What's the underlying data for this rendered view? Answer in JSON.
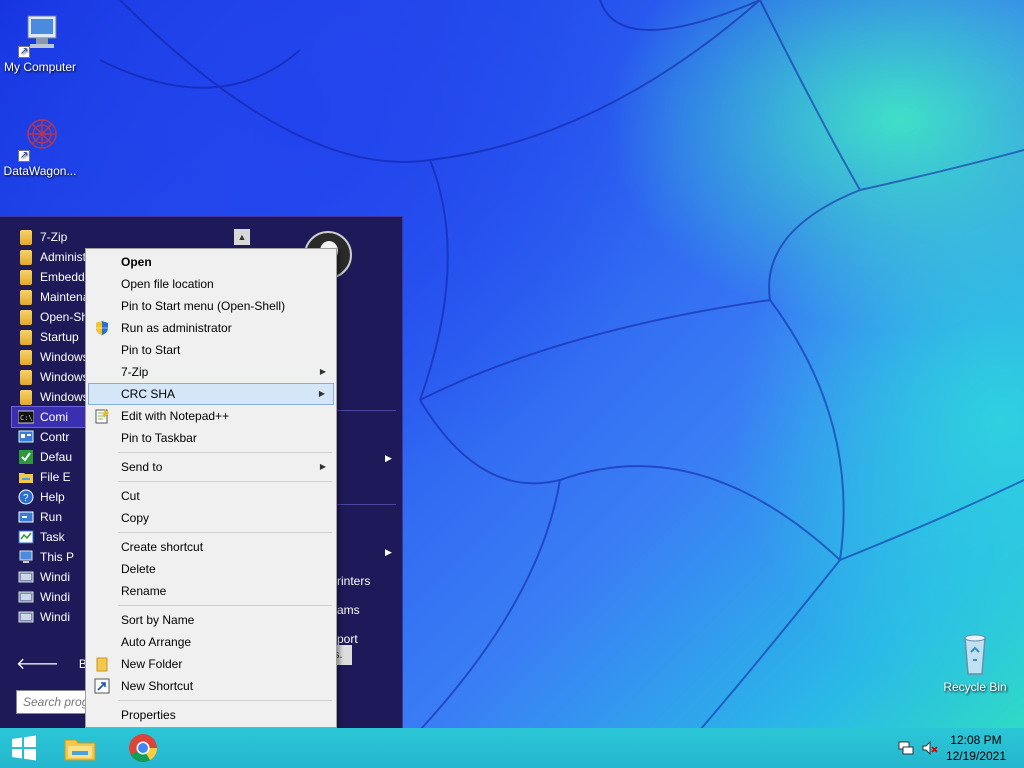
{
  "desktop": {
    "icons": [
      {
        "label": "My Computer",
        "icon": "my-computer-icon"
      },
      {
        "label": "DataWagon...",
        "icon": "datawagon-icon"
      },
      {
        "label": "Recycle Bin",
        "icon": "recycle-bin-icon"
      }
    ]
  },
  "start_menu": {
    "programs": [
      {
        "label": "7-Zip",
        "icon": "folder-icon"
      },
      {
        "label": "Administ",
        "icon": "folder-icon"
      },
      {
        "label": "Embedde",
        "icon": "folder-icon"
      },
      {
        "label": "Maintena",
        "icon": "folder-icon"
      },
      {
        "label": "Open-Sh",
        "icon": "folder-icon"
      },
      {
        "label": "Startup",
        "icon": "folder-icon"
      },
      {
        "label": "Windows",
        "icon": "folder-icon"
      },
      {
        "label": "Windows",
        "icon": "folder-icon"
      },
      {
        "label": "Windows",
        "icon": "folder-icon"
      },
      {
        "label": "Comi",
        "icon": "command-prompt-icon",
        "selected": true
      },
      {
        "label": "Contr",
        "icon": "control-panel-icon"
      },
      {
        "label": "Defau",
        "icon": "default-programs-icon"
      },
      {
        "label": "File E",
        "icon": "file-explorer-icon"
      },
      {
        "label": "Help",
        "icon": "help-icon"
      },
      {
        "label": "Run",
        "icon": "run-icon"
      },
      {
        "label": "Task",
        "icon": "task-manager-icon"
      },
      {
        "label": "This P",
        "icon": "this-pc-icon"
      },
      {
        "label": "Windi",
        "icon": "windows-tool-icon"
      },
      {
        "label": "Windi",
        "icon": "windows-tool-icon"
      },
      {
        "label": "Windi",
        "icon": "windows-tool-icon"
      }
    ],
    "right_labels": {
      "printers": "rinters",
      "programs": "ams",
      "support": "port",
      "hidden_btn": "s."
    },
    "back_label": "Back",
    "search_placeholder": "Search prog"
  },
  "context_menu": {
    "items": [
      {
        "label": "Open",
        "bold": true
      },
      {
        "label": "Open file location"
      },
      {
        "label": "Pin to Start menu (Open-Shell)"
      },
      {
        "label": "Run as administrator",
        "icon": "shield-icon"
      },
      {
        "label": "Pin to Start"
      },
      {
        "label": "7-Zip",
        "submenu": true
      },
      {
        "label": "CRC SHA",
        "submenu": true,
        "highlighted": true
      },
      {
        "label": "Edit with Notepad++",
        "icon": "notepad-plus-plus-icon"
      },
      {
        "label": "Pin to Taskbar"
      },
      {
        "separator": true
      },
      {
        "label": "Send to",
        "submenu": true
      },
      {
        "separator": true
      },
      {
        "label": "Cut"
      },
      {
        "label": "Copy"
      },
      {
        "separator": true
      },
      {
        "label": "Create shortcut"
      },
      {
        "label": "Delete"
      },
      {
        "label": "Rename"
      },
      {
        "separator": true
      },
      {
        "label": "Sort by Name"
      },
      {
        "label": "Auto Arrange"
      },
      {
        "label": "New Folder",
        "icon": "folder-icon"
      },
      {
        "label": "New Shortcut",
        "icon": "shortcut-icon"
      },
      {
        "separator": true
      },
      {
        "label": "Properties"
      }
    ]
  },
  "taskbar": {
    "buttons": [
      "start-button",
      "file-explorer-icon",
      "chrome-icon"
    ],
    "clock": {
      "time": "12:08 PM",
      "date": "12/19/2021"
    }
  },
  "colors": {
    "start_menu_bg": "#1e1a5a",
    "taskbar_bg": "#2bc7d7",
    "context_highlight": "#d5e6f8"
  }
}
